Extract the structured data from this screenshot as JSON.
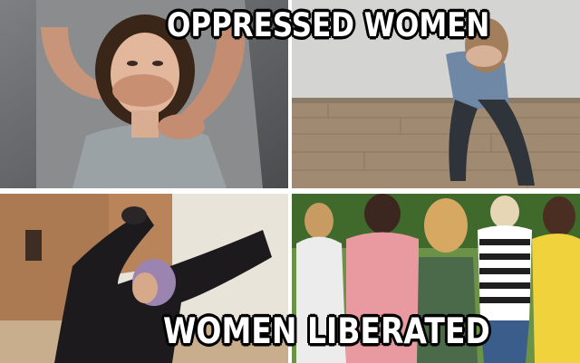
{
  "meme": {
    "top_caption": "OPPRESSED WOMEN",
    "bottom_caption": "WOMEN LIBERATED"
  },
  "colors": {
    "caption_fill": "#ffffff",
    "caption_outline": "#000000",
    "divider": "#ffffff"
  }
}
